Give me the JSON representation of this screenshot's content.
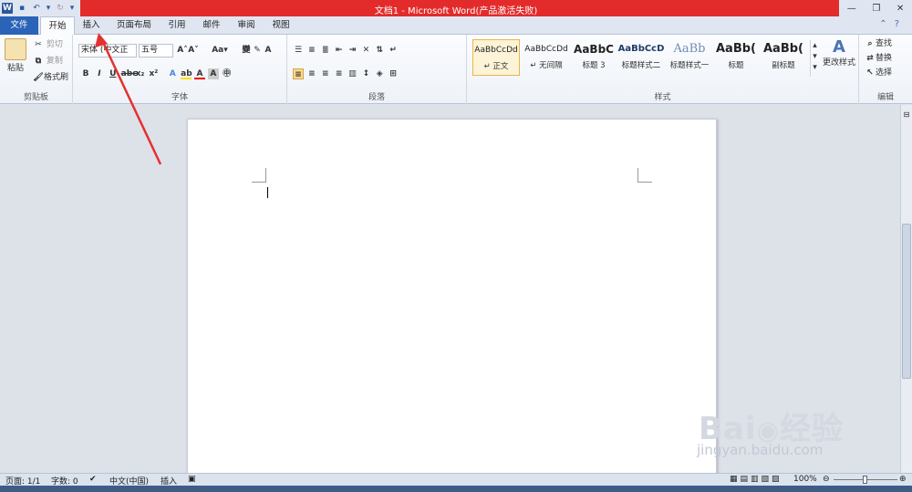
{
  "window": {
    "title": "文档1 - Microsoft Word(产品激活失败)"
  },
  "tabs": [
    {
      "label": "文件"
    },
    {
      "label": "开始"
    },
    {
      "label": "插入"
    },
    {
      "label": "页面布局"
    },
    {
      "label": "引用"
    },
    {
      "label": "邮件"
    },
    {
      "label": "审阅"
    },
    {
      "label": "视图"
    }
  ],
  "clipboard": {
    "paste": "粘贴",
    "cut": "剪切",
    "copy": "复制",
    "format_painter": "格式刷",
    "label": "剪贴板"
  },
  "font": {
    "name": "宋体 (中文正",
    "size": "五号",
    "label": "字体"
  },
  "paragraph": {
    "label": "段落"
  },
  "styles": {
    "items": [
      {
        "preview": "AaBbCcDd",
        "name": "↵ 正文"
      },
      {
        "preview": "AaBbCcDd",
        "name": "↵ 无间隔"
      },
      {
        "preview": "AaBbC",
        "name": "标题 3"
      },
      {
        "preview": "AaBbCcD",
        "name": "标题样式二"
      },
      {
        "preview": "AaBb",
        "name": "标题样式一"
      },
      {
        "preview": "AaBb(",
        "name": "标题"
      },
      {
        "preview": "AaBb(",
        "name": "副标题"
      }
    ],
    "change": "更改样式",
    "label": "样式"
  },
  "editing": {
    "find": "查找",
    "replace": "替换",
    "select": "选择",
    "label": "编辑"
  },
  "status": {
    "page": "页面: 1/1",
    "words": "字数: 0",
    "language": "中文(中国)",
    "mode": "插入",
    "zoom": "100%"
  },
  "watermark": {
    "brand": "Bai",
    "brand2": "经验",
    "url": "jingyan.baidu.com"
  }
}
